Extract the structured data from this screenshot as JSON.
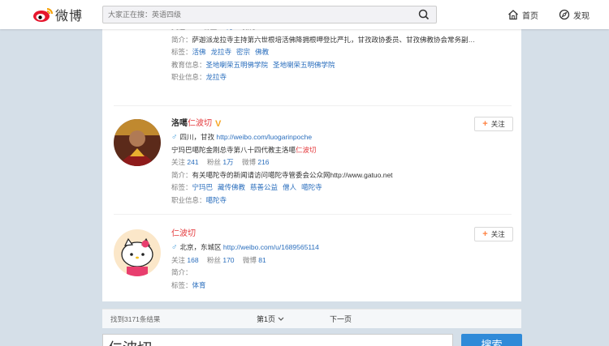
{
  "header": {
    "logo_text": "微博",
    "search_placeholder": "大家正在搜：英语四级",
    "nav": [
      {
        "label": "首页",
        "icon": "home-icon"
      },
      {
        "label": "发现",
        "icon": "discover-icon"
      }
    ]
  },
  "users": [
    {
      "partial_top_text": "……………………………………………………",
      "follow_label": "关注",
      "follow_count": "94",
      "fans_label": "粉丝",
      "fans_count": "16万",
      "weibo_label": "微博",
      "weibo_count": "1708",
      "bio_label": "简介：",
      "bio": "萨迦派龙拉寺主持第六世根培活佛降拥根呷登比严扎，甘孜政协委员、甘孜佛教协会常务副…",
      "tags_label": "标签：",
      "tags": [
        "活佛",
        "龙拉寺",
        "密宗",
        "佛教"
      ],
      "edu_label": "教育信息：",
      "edu": [
        "圣地喇荣五明佛学院",
        "圣地喇荣五明佛学院"
      ],
      "job_label": "职业信息：",
      "job": "龙拉寺"
    },
    {
      "name_prefix": "洛噶",
      "name_highlight": "仁波切",
      "verified": "V",
      "gender": "♂",
      "location": "四川，甘孜",
      "url": "http://weibo.com/luogarinpoche",
      "desc_prefix": "宁玛巴噶陀金刚总寺第八十四代教主洛噶",
      "desc_highlight": "仁波切",
      "follow_label": "关注",
      "follow_count": "241",
      "fans_label": "粉丝",
      "fans_count": "1万",
      "weibo_label": "微博",
      "weibo_count": "216",
      "bio_label": "简介：",
      "bio": "有关噶陀寺的新闻请访问噶陀寺管委会公众网http://www.gatuo.net",
      "tags_label": "标签：",
      "tags": [
        "宁玛巴",
        "藏传佛教",
        "慈善公益",
        "僧人",
        "噶陀寺"
      ],
      "job_label": "职业信息：",
      "job": "噶陀寺",
      "button": "关注"
    },
    {
      "name_highlight": "仁波切",
      "gender": "♂",
      "location": "北京，东城区",
      "url": "http://weibo.com/u/1689565114",
      "follow_label": "关注",
      "follow_count": "168",
      "fans_label": "粉丝",
      "fans_count": "170",
      "weibo_label": "微博",
      "weibo_count": "81",
      "bio_label": "简介：",
      "tags_label": "标签：",
      "tags": [
        "体育"
      ],
      "button": "关注"
    }
  ],
  "pager": {
    "total": "找到3171条结果",
    "page": "第1页",
    "next": "下一页"
  },
  "bottom": {
    "query": "仁波切",
    "button": "搜索"
  },
  "colors": {
    "link": "#2a6ebd",
    "highlight": "#e4393c",
    "follow_plus": "#ff8140",
    "bg": "#d5dfe8"
  }
}
